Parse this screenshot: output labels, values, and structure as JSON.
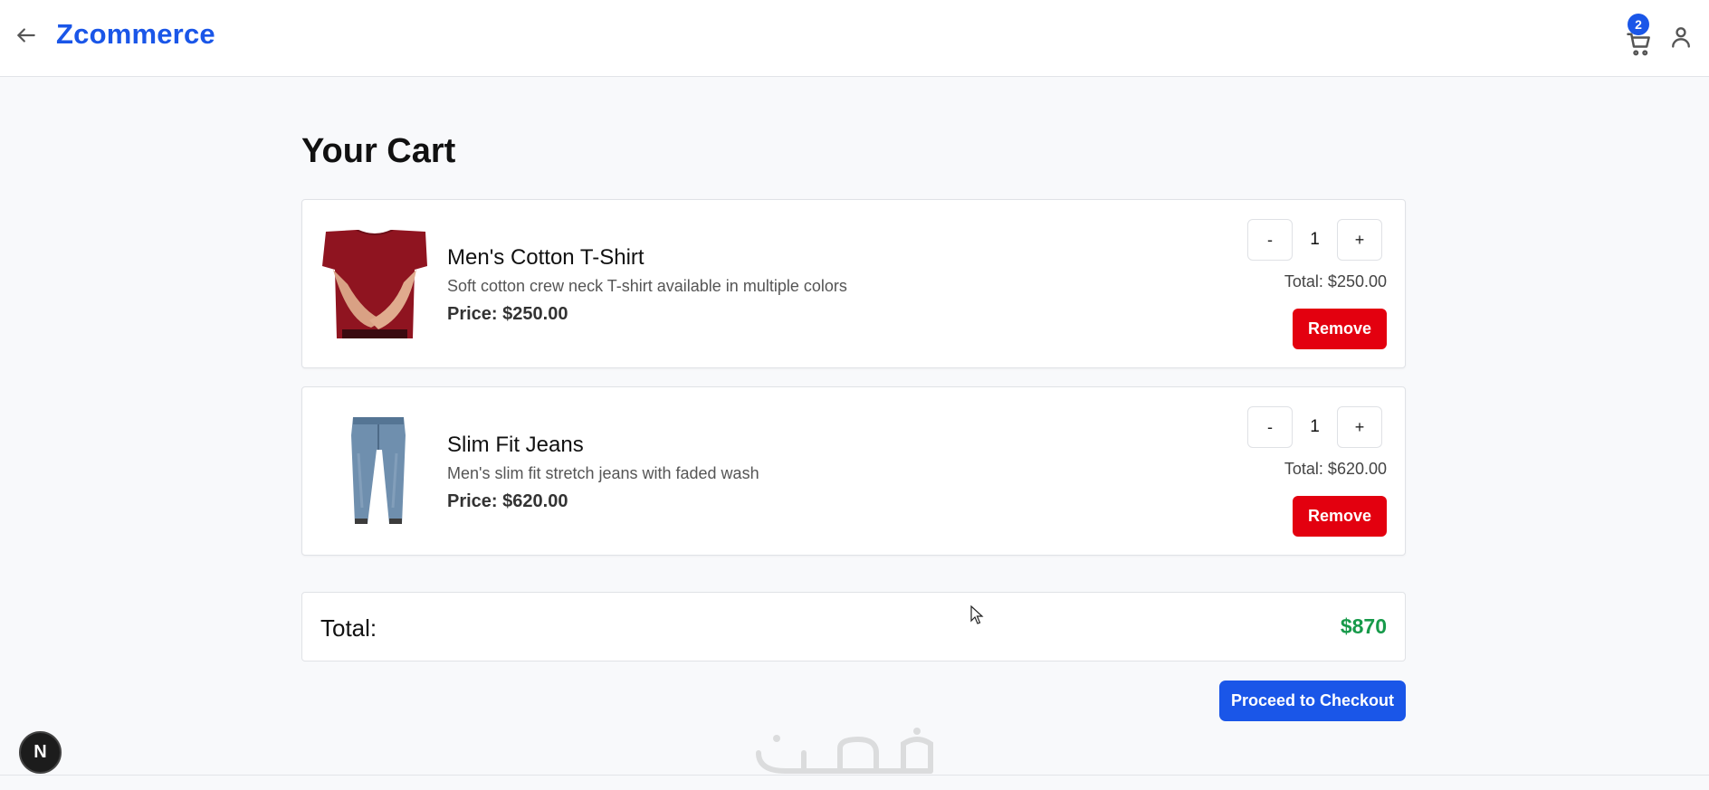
{
  "header": {
    "brand": "Zcommerce",
    "cart_count": "2"
  },
  "page": {
    "title": "Your Cart"
  },
  "cart": {
    "items": [
      {
        "name": "Men's Cotton T-Shirt",
        "description": "Soft cotton crew neck T-shirt available in multiple colors",
        "price": "Price: $250.00",
        "quantity": "1",
        "line_total": "Total: $250.00",
        "decrement": "-",
        "increment": "+",
        "remove_label": "Remove",
        "image_icon": "tshirt-image"
      },
      {
        "name": "Slim Fit Jeans",
        "description": "Men's slim fit stretch jeans with faded wash",
        "price": "Price: $620.00",
        "quantity": "1",
        "line_total": "Total: $620.00",
        "decrement": "-",
        "increment": "+",
        "remove_label": "Remove",
        "image_icon": "jeans-image"
      }
    ],
    "total_label": "Total:",
    "total_value": "$870",
    "checkout_label": "Proceed to Checkout"
  },
  "dev_indicator": "N",
  "colors": {
    "brand": "#1a56e8",
    "remove": "#e3000f",
    "total": "#179a4a",
    "background": "#f8f9fb"
  }
}
